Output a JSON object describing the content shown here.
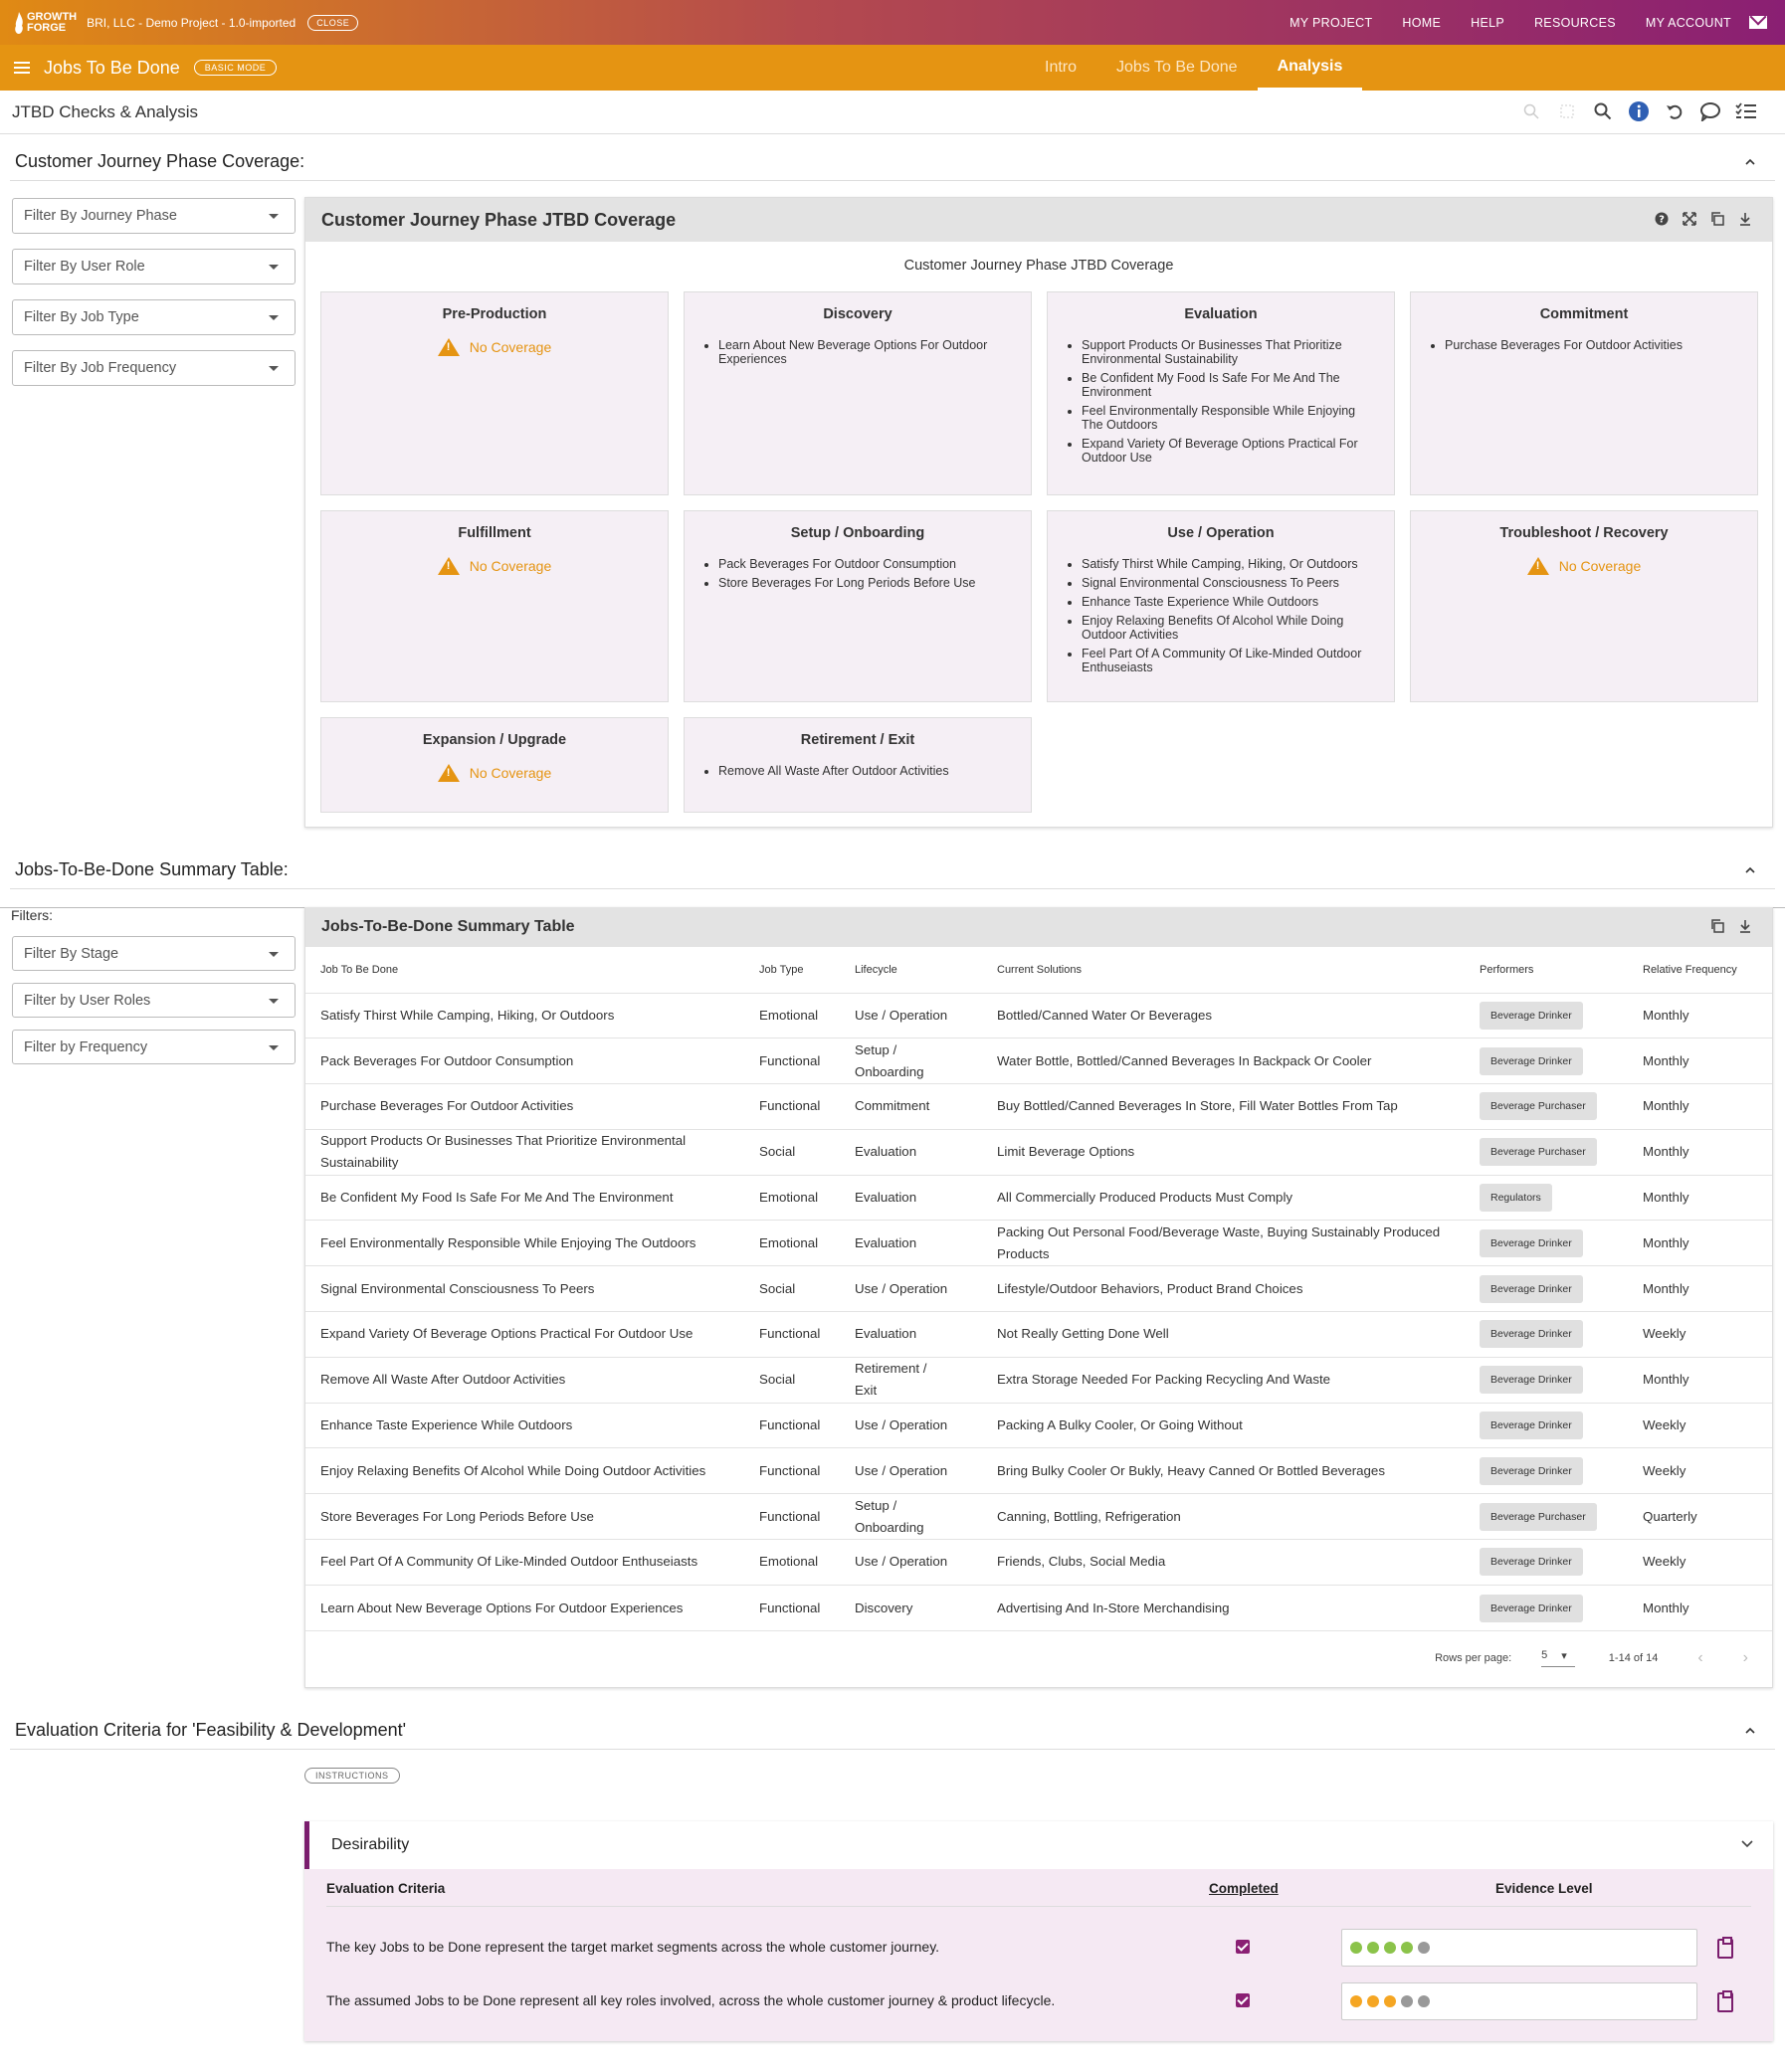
{
  "topbar": {
    "logo_line1": "GROWTH",
    "logo_line2": "FORGE",
    "project": "BRI, LLC - Demo Project - 1.0-imported",
    "close": "CLOSE",
    "nav": [
      "MY PROJECT",
      "HOME",
      "HELP",
      "RESOURCES",
      "MY ACCOUNT"
    ]
  },
  "subbar": {
    "title": "Jobs To Be Done",
    "mode": "BASIC MODE",
    "tabs": [
      "Intro",
      "Jobs To Be Done",
      "Analysis"
    ],
    "active_tab": "Analysis"
  },
  "pagebar": {
    "title": "JTBD Checks & Analysis"
  },
  "coverage": {
    "heading": "Customer Journey Phase Coverage:",
    "filters": [
      "Filter By Journey Phase",
      "Filter By User Role",
      "Filter By Job Type",
      "Filter By Job Frequency"
    ],
    "panel_title": "Customer Journey Phase JTBD Coverage",
    "chart_title": "Customer Journey Phase JTBD Coverage",
    "no_coverage": "No Coverage",
    "phases": [
      {
        "name": "Pre-Production",
        "jobs": []
      },
      {
        "name": "Discovery",
        "jobs": [
          "Learn About New Beverage Options For Outdoor Experiences"
        ]
      },
      {
        "name": "Evaluation",
        "jobs": [
          "Support Products Or Businesses That Prioritize Environmental Sustainability",
          "Be Confident My Food Is Safe For Me And The Environment",
          "Feel Environmentally Responsible While Enjoying The Outdoors",
          "Expand Variety Of Beverage Options Practical For Outdoor Use"
        ]
      },
      {
        "name": "Commitment",
        "jobs": [
          "Purchase Beverages For Outdoor Activities"
        ]
      },
      {
        "name": "Fulfillment",
        "jobs": []
      },
      {
        "name": "Setup / Onboarding",
        "jobs": [
          "Pack Beverages For Outdoor Consumption",
          "Store Beverages For Long Periods Before Use"
        ]
      },
      {
        "name": "Use / Operation",
        "jobs": [
          "Satisfy Thirst While Camping, Hiking, Or Outdoors",
          "Signal Environmental Consciousness To Peers",
          "Enhance Taste Experience While Outdoors",
          "Enjoy Relaxing Benefits Of Alcohol While Doing Outdoor Activities",
          "Feel Part Of A Community Of Like-Minded Outdoor Enthuseiasts"
        ]
      },
      {
        "name": "Troubleshoot / Recovery",
        "jobs": []
      },
      {
        "name": "Expansion / Upgrade",
        "jobs": []
      },
      {
        "name": "Retirement / Exit",
        "jobs": [
          "Remove All Waste After Outdoor Activities"
        ]
      }
    ]
  },
  "summary": {
    "heading": "Jobs-To-Be-Done Summary Table:",
    "filters_label": "Filters:",
    "filters": [
      "Filter By Stage",
      "Filter by User Roles",
      "Filter by Frequency"
    ],
    "panel_title": "Jobs-To-Be-Done Summary Table",
    "columns": [
      "Job To Be Done",
      "Job Type",
      "Lifecycle",
      "Current Solutions",
      "Performers",
      "Relative Frequency"
    ],
    "rows": [
      [
        "Satisfy Thirst While Camping, Hiking, Or Outdoors",
        "Emotional",
        "Use / Operation",
        "Bottled/Canned Water Or Beverages",
        "Beverage Drinker",
        "Monthly"
      ],
      [
        "Pack Beverages For Outdoor Consumption",
        "Functional",
        "Setup / Onboarding",
        "Water Bottle, Bottled/Canned Beverages In Backpack Or Cooler",
        "Beverage Drinker",
        "Monthly"
      ],
      [
        "Purchase Beverages For Outdoor Activities",
        "Functional",
        "Commitment",
        "Buy Bottled/Canned Beverages In Store, Fill Water Bottles From Tap",
        "Beverage Purchaser",
        "Monthly"
      ],
      [
        "Support Products Or Businesses That Prioritize Environmental Sustainability",
        "Social",
        "Evaluation",
        "Limit Beverage Options",
        "Beverage Purchaser",
        "Monthly"
      ],
      [
        "Be Confident My Food Is Safe For Me And The Environment",
        "Emotional",
        "Evaluation",
        "All Commercially Produced Products Must Comply",
        "Regulators",
        "Monthly"
      ],
      [
        "Feel Environmentally Responsible While Enjoying The Outdoors",
        "Emotional",
        "Evaluation",
        "Packing Out Personal Food/Beverage Waste, Buying Sustainably Produced Products",
        "Beverage Drinker",
        "Monthly"
      ],
      [
        "Signal Environmental Consciousness To Peers",
        "Social",
        "Use / Operation",
        "Lifestyle/Outdoor Behaviors, Product Brand Choices",
        "Beverage Drinker",
        "Monthly"
      ],
      [
        "Expand Variety Of Beverage Options Practical For Outdoor Use",
        "Functional",
        "Evaluation",
        "Not Really Getting Done Well",
        "Beverage Drinker",
        "Weekly"
      ],
      [
        "Remove All Waste After Outdoor Activities",
        "Social",
        "Retirement / Exit",
        "Extra Storage Needed For Packing Recycling And Waste",
        "Beverage Drinker",
        "Monthly"
      ],
      [
        "Enhance Taste Experience While Outdoors",
        "Functional",
        "Use / Operation",
        "Packing A Bulky Cooler, Or Going Without",
        "Beverage Drinker",
        "Weekly"
      ],
      [
        "Enjoy Relaxing Benefits Of Alcohol While Doing Outdoor Activities",
        "Functional",
        "Use / Operation",
        "Bring Bulky Cooler Or Bukly, Heavy Canned Or Bottled Beverages",
        "Beverage Drinker",
        "Weekly"
      ],
      [
        "Store Beverages For Long Periods Before Use",
        "Functional",
        "Setup / Onboarding",
        "Canning, Bottling, Refrigeration",
        "Beverage Purchaser",
        "Quarterly"
      ],
      [
        "Feel Part Of A Community Of Like-Minded Outdoor Enthuseiasts",
        "Emotional",
        "Use / Operation",
        "Friends, Clubs, Social Media",
        "Beverage Drinker",
        "Weekly"
      ],
      [
        "Learn About New Beverage Options For Outdoor Experiences",
        "Functional",
        "Discovery",
        "Advertising And In-Store Merchandising",
        "Beverage Drinker",
        "Monthly"
      ]
    ],
    "rows_per_page_label": "Rows per page:",
    "rows_per_page": "5",
    "range": "1-14 of 14"
  },
  "evaluation": {
    "heading": "Evaluation Criteria for 'Feasibility & Development'",
    "instructions": "INSTRUCTIONS",
    "group": "Desirability",
    "col_criteria": "Evaluation Criteria",
    "col_completed": "Completed",
    "col_evidence": "Evidence Level",
    "rows": [
      {
        "text": "The key Jobs to be Done represent the target market segments across the whole customer journey.",
        "completed": true,
        "evidence_level": 4,
        "evidence_color": "#8bc34a"
      },
      {
        "text": "The assumed Jobs to be Done represent all key roles involved, across the whole customer journey & product lifecycle.",
        "completed": true,
        "evidence_level": 3,
        "evidence_color": "#f5a623"
      }
    ]
  },
  "colors": {
    "accent": "#e59412",
    "brand_purple": "#8a1f73"
  }
}
